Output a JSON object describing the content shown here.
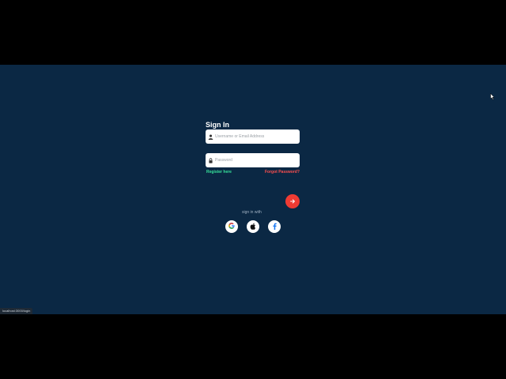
{
  "page": {
    "title": "Sign In"
  },
  "form": {
    "username": {
      "value": "",
      "placeholder": "Username or Email Address",
      "icon": "user-icon"
    },
    "password": {
      "value": "",
      "placeholder": "Password",
      "icon": "lock-icon"
    },
    "register_label": "Register here",
    "forgot_label": "Forgot Password?",
    "submit_icon": "arrow-right-icon"
  },
  "social": {
    "label": "sign in with",
    "providers": [
      "google-icon",
      "apple-icon",
      "facebook-icon"
    ]
  },
  "statusbar": {
    "url": "localhost:3000/login"
  },
  "colors": {
    "background": "#0b2844",
    "register": "#37e39a",
    "forgot": "#ff4f4f",
    "submit": "#ef3b33"
  }
}
